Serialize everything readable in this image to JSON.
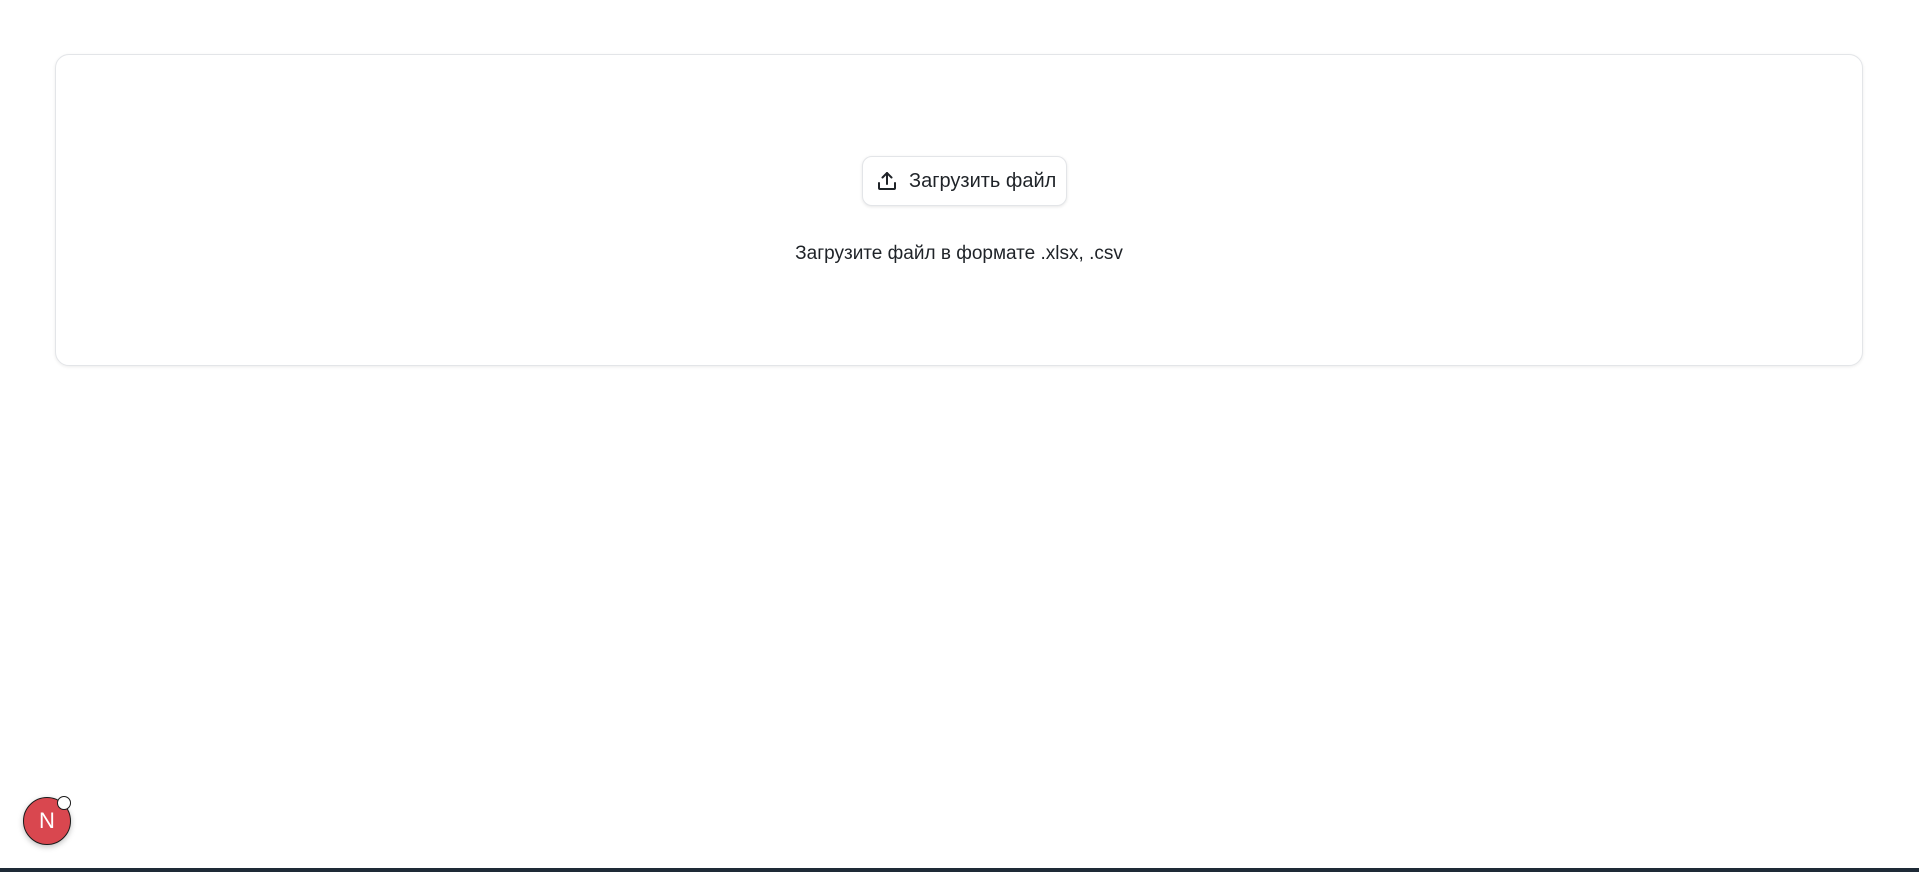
{
  "upload": {
    "button_label": "Загрузить файл",
    "button_icon": "upload-icon",
    "hint": "Загрузите файл в формате .xlsx, .csv"
  },
  "avatar": {
    "initial": "N",
    "color": "#d9474f"
  }
}
